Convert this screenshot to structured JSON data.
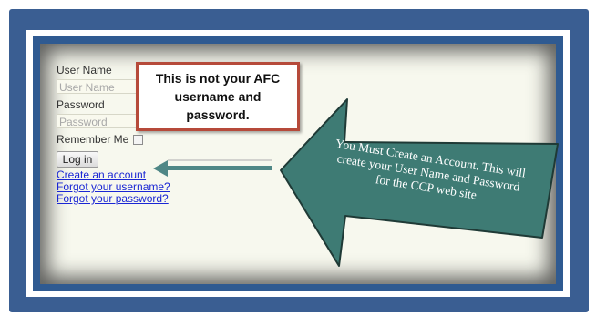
{
  "login_form": {
    "username_label": "User Name",
    "username_placeholder": "User Name",
    "password_label": "Password",
    "password_placeholder": "Password",
    "remember_label": "Remember Me",
    "login_button": "Log in",
    "links": [
      "Create an account",
      "Forgot your username?",
      "Forgot your password?"
    ]
  },
  "callout_note": "This is not your AFC username and password.",
  "arrow_note": "You Must Create an Account. This will create your User Name and Password for the CCP web site",
  "colors": {
    "frame": "#3a5e92",
    "callout_border": "#b64a3a",
    "arrow_fill": "#3e7b74",
    "link": "#1a26d4"
  }
}
